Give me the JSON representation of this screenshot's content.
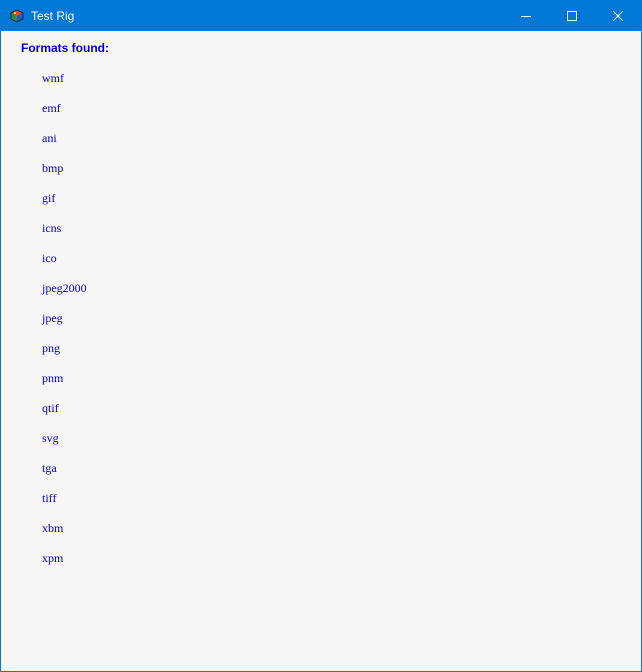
{
  "window": {
    "title": "Test Rig",
    "title_bar_color": "#0078d7",
    "icons": {
      "app": "colored-cube-icon",
      "minimize": "minimize-icon",
      "maximize": "maximize-icon",
      "close": "close-icon"
    }
  },
  "content": {
    "heading": "Formats found:",
    "text_color": "#0000cc",
    "formats": [
      "wmf",
      "emf",
      "ani",
      "bmp",
      "gif",
      "icns",
      "ico",
      "jpeg2000",
      "jpeg",
      "png",
      "pnm",
      "qtif",
      "svg",
      "tga",
      "tiff",
      "xbm",
      "xpm"
    ]
  }
}
